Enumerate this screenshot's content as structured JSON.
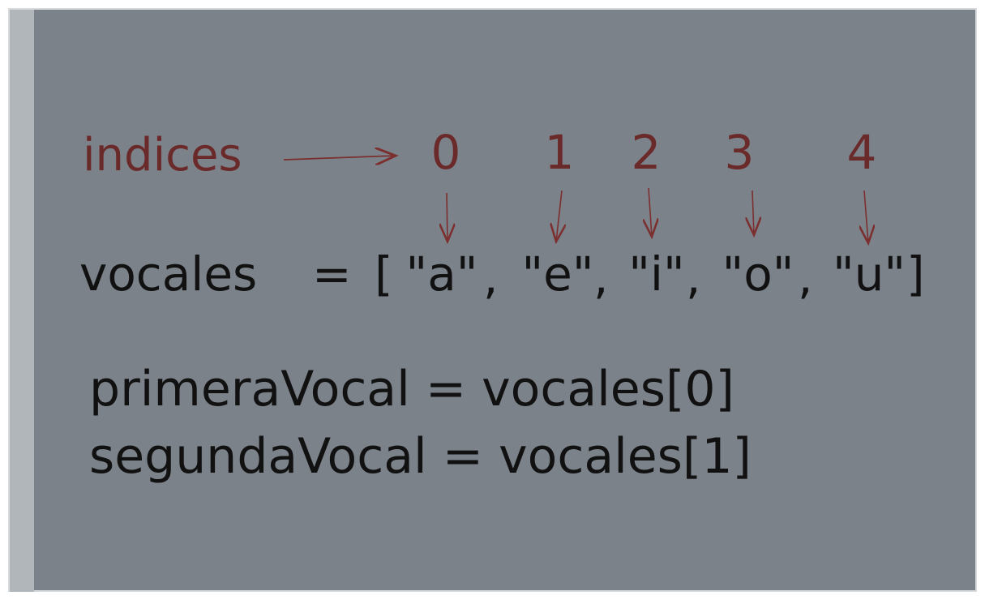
{
  "index_label": "indices",
  "indices": [
    "0",
    "1",
    "2",
    "3",
    "4"
  ],
  "array_line": {
    "variable": "vocales",
    "equals": "=",
    "open_bracket": "[",
    "close_bracket": "]",
    "elements": [
      "\"a\"",
      "\"e\"",
      "\"i\"",
      "\"o\"",
      "\"u\""
    ],
    "separator": ","
  },
  "statements": [
    "primeraVocal = vocales[0]",
    "segundaVocal = vocales[1]"
  ],
  "colors": {
    "background": "#7c828a",
    "annotation": "#6b2a2a",
    "code": "#111111"
  }
}
